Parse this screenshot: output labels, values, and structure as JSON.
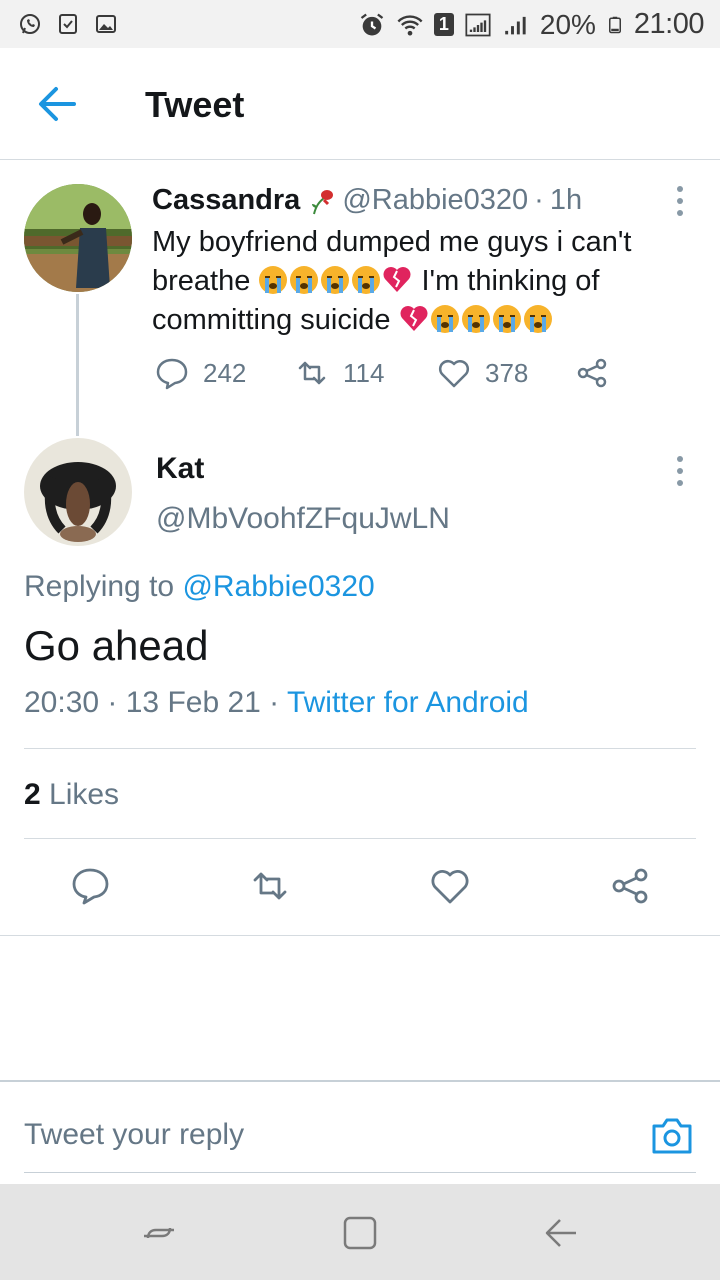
{
  "status_bar": {
    "left_icons": [
      "whatsapp-icon",
      "checkbox-icon",
      "image-icon"
    ],
    "right_icons": [
      "alarm-icon",
      "wifi-icon",
      "sim-icon",
      "signal-icon",
      "battery-icon"
    ],
    "sim_number": "1",
    "battery": "20%",
    "time": "21:00"
  },
  "header": {
    "title": "Tweet",
    "back_icon": "arrow-left-icon"
  },
  "parent_tweet": {
    "name": "Cassandra",
    "name_emoji": "wilted-rose",
    "handle": "@Rabbie0320",
    "time": "1h",
    "text_parts": [
      "My boyfriend dumped me guys i can't breathe ",
      " I'm thinking of committing suicide "
    ],
    "emojis": [
      "loudly-crying-face",
      "broken-heart"
    ],
    "replies": "242",
    "retweets": "114",
    "likes": "378"
  },
  "reply_tweet": {
    "name": "Kat",
    "handle": "@MbVoohfZFquJwLN",
    "replying_prefix": "Replying to ",
    "replying_to": "@Rabbie0320",
    "text": "Go ahead",
    "date": "20:30 · 13 Feb 21 · ",
    "source": "Twitter for Android",
    "likes_count": "2",
    "likes_label": " Likes"
  },
  "reply_bar": {
    "placeholder": "Tweet your reply",
    "camera_icon": "camera-icon"
  },
  "nav_bar": {
    "icons": [
      "recent-apps-icon",
      "home-icon",
      "back-icon"
    ]
  },
  "colors": {
    "accent": "#1b95e0",
    "secondary_text": "#657786",
    "primary_text": "#14171a",
    "divider": "#d5dbe0"
  }
}
